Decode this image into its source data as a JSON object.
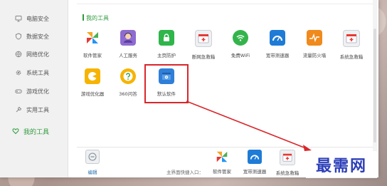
{
  "sidebar": {
    "items": [
      {
        "label": "电脑安全",
        "icon": "monitor-icon"
      },
      {
        "label": "数据安全",
        "icon": "shield-icon"
      },
      {
        "label": "网络优化",
        "icon": "network-icon"
      },
      {
        "label": "系统工具",
        "icon": "gear-icon"
      },
      {
        "label": "游戏优化",
        "icon": "gamepad-icon"
      },
      {
        "label": "实用工具",
        "icon": "wrench-icon"
      },
      {
        "label": "我的工具",
        "icon": "heart-icon",
        "active": true
      }
    ]
  },
  "section": {
    "title": "我的工具"
  },
  "tools": [
    {
      "label": "软件管家",
      "icon": "pinwheel-icon",
      "color": "#f5a623"
    },
    {
      "label": "人工服务",
      "icon": "agent-icon",
      "color": "#8e6bd1"
    },
    {
      "label": "主页防护",
      "icon": "lock-icon",
      "color": "#2fb54a"
    },
    {
      "label": "断网急救箱",
      "icon": "first-aid-icon",
      "color": "#e9ecef"
    },
    {
      "label": "免费WiFi",
      "icon": "wifi-icon",
      "color": "#33b44a"
    },
    {
      "label": "宽带测速器",
      "icon": "speedometer-icon",
      "color": "#1f7bd6"
    },
    {
      "label": "流量防火墙",
      "icon": "traffic-icon",
      "color": "#f08a1c"
    },
    {
      "label": "系统急救箱",
      "icon": "first-aid-icon",
      "color": "#e9ecef"
    },
    {
      "label": "游戏优化器",
      "icon": "game-icon",
      "color": "#f6b400"
    },
    {
      "label": "360问答",
      "icon": "question-icon",
      "color": "#f6b400"
    },
    {
      "label": "默认软件",
      "icon": "settings-window-icon",
      "color": "#2f7fd8"
    }
  ],
  "bottom": {
    "edit_label": "编辑",
    "quick_label": "主界面快捷入口：",
    "quick_items": [
      {
        "label": "软件管家",
        "icon": "pinwheel-icon"
      },
      {
        "label": "宽带测速器",
        "icon": "speedometer-icon"
      },
      {
        "label": "系统急救箱",
        "icon": "first-aid-icon"
      }
    ]
  },
  "watermark": {
    "text": "最需网"
  }
}
